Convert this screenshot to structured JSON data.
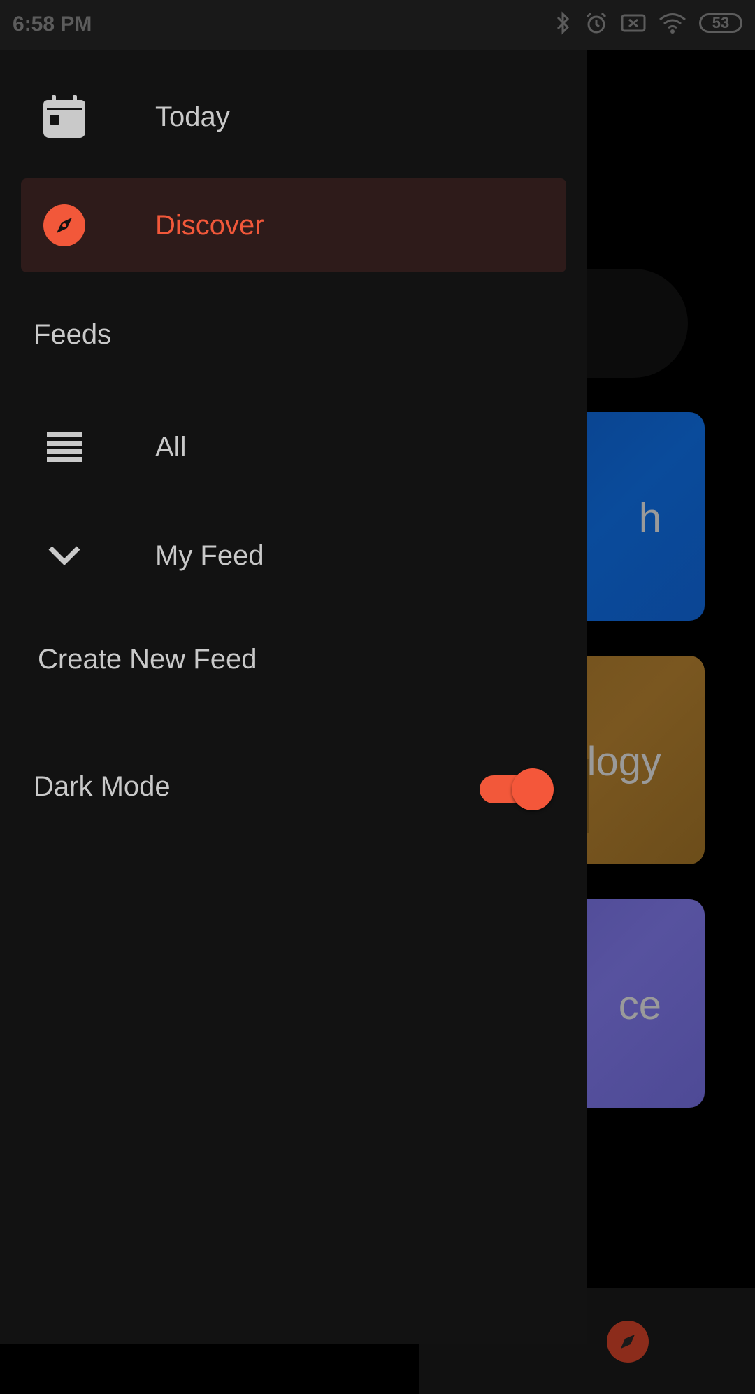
{
  "status_bar": {
    "time": "6:58 PM",
    "battery": "53",
    "icons": [
      "bluetooth-icon",
      "alarm-icon",
      "sim-off-icon",
      "wifi-icon",
      "battery-icon"
    ]
  },
  "drawer": {
    "items": [
      {
        "label": "Today",
        "icon": "calendar-icon"
      },
      {
        "label": "Discover",
        "icon": "compass-icon",
        "selected": true
      }
    ],
    "feeds_title": "Feeds",
    "feed_items": [
      {
        "label": "All",
        "icon": "menu-icon"
      },
      {
        "label": "My Feed",
        "icon": "chevron-down-icon"
      }
    ],
    "create_feed": "Create New Feed",
    "dark_mode": {
      "label": "Dark Mode",
      "enabled": true
    }
  },
  "background": {
    "cards": [
      {
        "label": "h"
      },
      {
        "label": "logy"
      },
      {
        "label": "ce"
      }
    ]
  },
  "colors": {
    "accent": "#f2583a",
    "drawer_bg": "#121212",
    "selected_bg": "#2e1b1a",
    "text": "#c9c9c9"
  }
}
